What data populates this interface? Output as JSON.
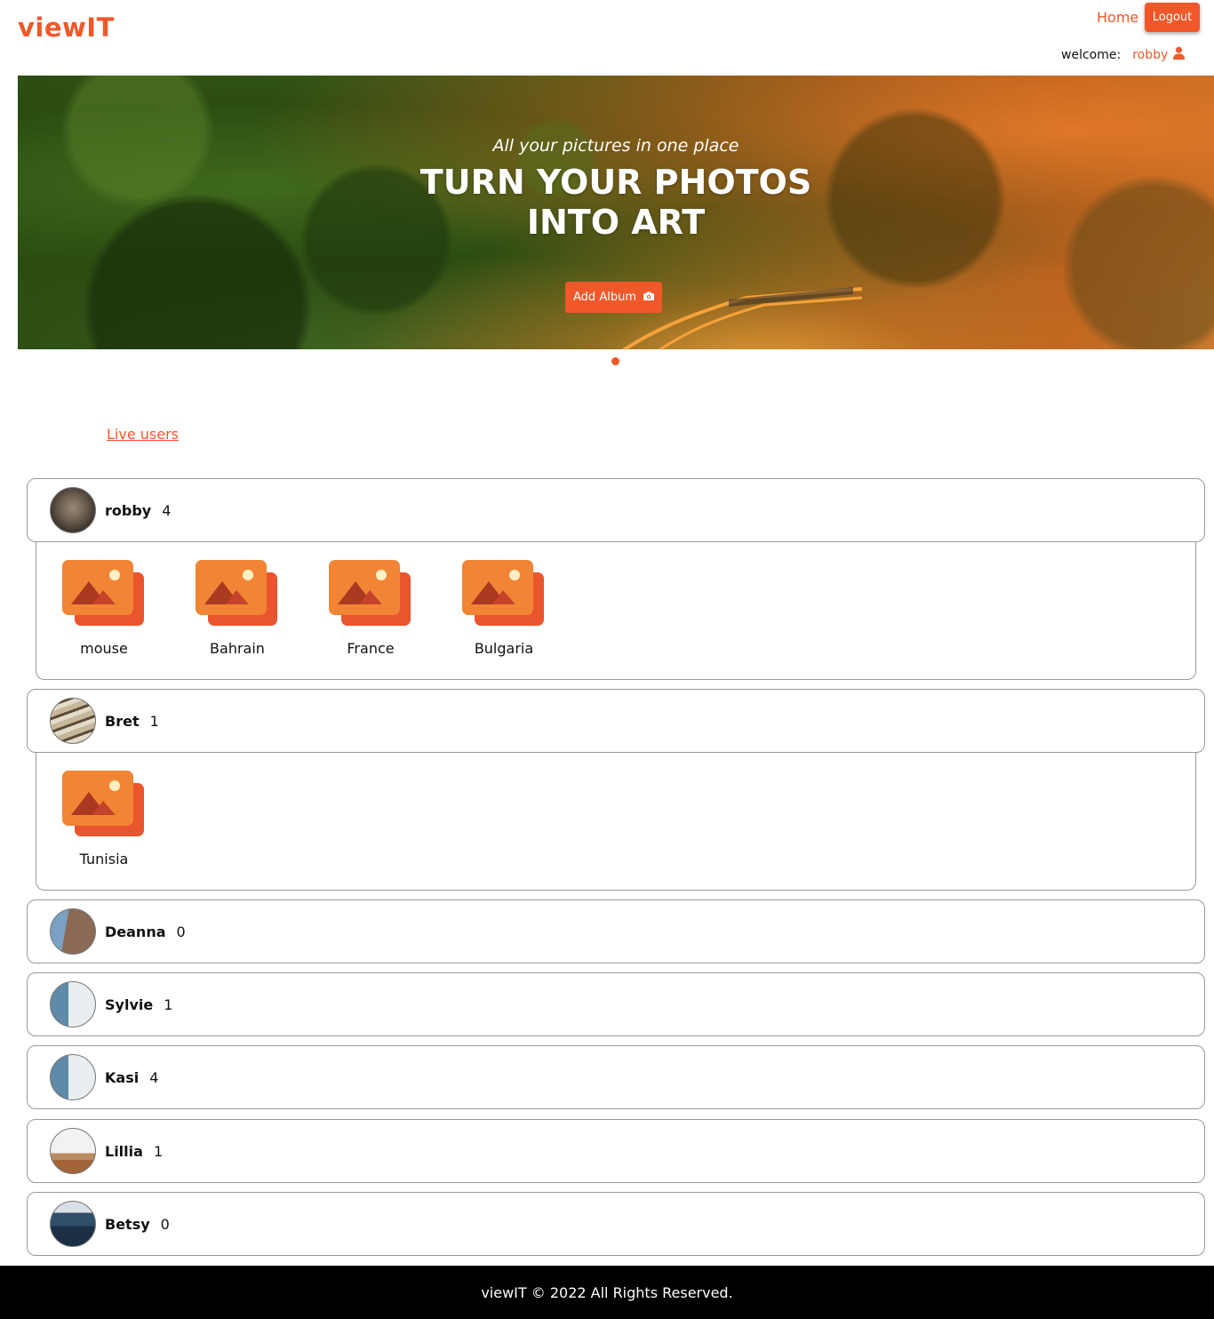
{
  "header": {
    "brand": "viewIT",
    "home_label": "Home",
    "logout_label": "Logout",
    "welcome_label": "welcome:",
    "username": "robby"
  },
  "hero": {
    "subtitle": "All your pictures in one place",
    "title_line1": "TURN YOUR PHOTOS",
    "title_line2": "INTO ART",
    "add_album_label": "Add Album"
  },
  "live_users_label": "Live users",
  "users": [
    {
      "name": "robby",
      "count": "4",
      "albums": [
        "mouse",
        "Bahrain",
        "France",
        "Bulgaria"
      ]
    },
    {
      "name": "Bret",
      "count": "1",
      "albums": [
        "Tunisia"
      ]
    },
    {
      "name": "Deanna",
      "count": "0"
    },
    {
      "name": "Sylvie",
      "count": "1"
    },
    {
      "name": "Kasi",
      "count": "4"
    },
    {
      "name": "Lillia",
      "count": "1"
    },
    {
      "name": "Betsy",
      "count": "0"
    }
  ],
  "footer": "viewIT © 2022 All Rights Reserved.",
  "colors": {
    "accent": "#f0582a",
    "album_icon_front": "#f28535",
    "album_icon_back": "#e9552c"
  },
  "icons": {
    "user": "user-icon",
    "camera": "camera-icon",
    "album": "image-icon"
  }
}
